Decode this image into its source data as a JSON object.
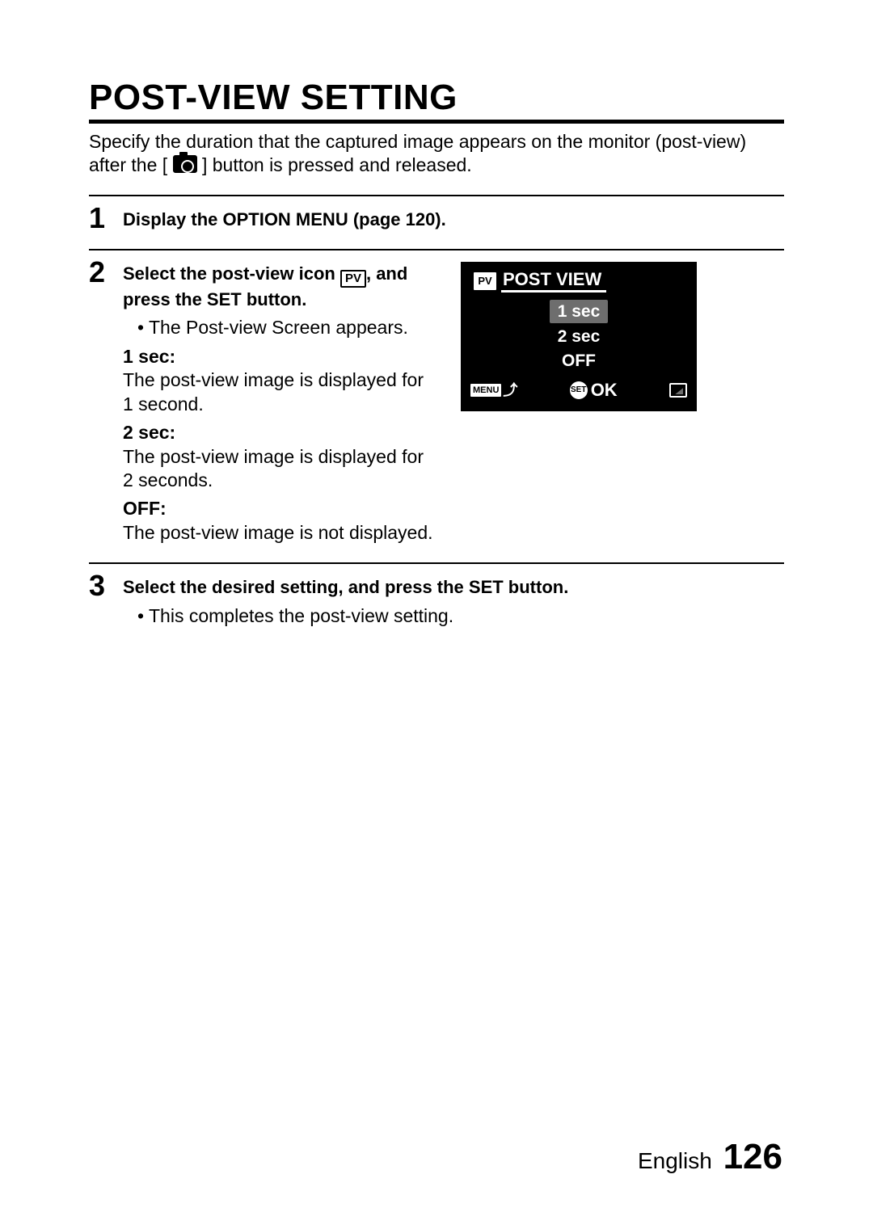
{
  "title": "POST-VIEW SETTING",
  "intro_before_icon": "Specify the duration that the captured image appears on the monitor (post-view) after the [ ",
  "intro_after_icon": " ] button is pressed and released.",
  "steps": {
    "s1": {
      "num": "1",
      "head": "Display the OPTION MENU (page 120)."
    },
    "s2": {
      "num": "2",
      "head_before": "Select the post-view icon ",
      "pv_label": "PV",
      "head_after": ", and press the SET button.",
      "bullet": "The Post-view Screen appears.",
      "opt1_label": "1 sec:",
      "opt1_desc": "The post-view image is displayed for 1 second.",
      "opt2_label": "2 sec:",
      "opt2_desc": "The post-view image is displayed for 2 seconds.",
      "opt3_label": "OFF:",
      "opt3_desc": "The post-view image is not displayed."
    },
    "s3": {
      "num": "3",
      "head": "Select the desired setting, and press the SET button.",
      "bullet": "This completes the post-view setting."
    }
  },
  "lcd": {
    "pv_badge": "PV",
    "title": "POST VIEW",
    "options": [
      "1 sec",
      "2 sec",
      "OFF"
    ],
    "menu": "MENU",
    "set": "SET",
    "ok": "OK"
  },
  "footer": {
    "lang": "English",
    "page": "126"
  }
}
